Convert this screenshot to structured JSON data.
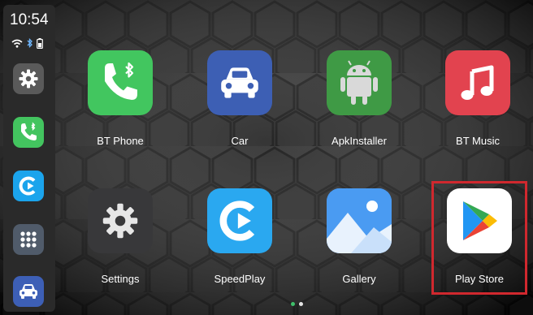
{
  "status": {
    "time": "10:54",
    "icons": [
      "wifi-icon",
      "bluetooth-icon",
      "battery-icon"
    ]
  },
  "sidebar": {
    "items": [
      {
        "name": "settings",
        "icon": "gear-icon",
        "color": "#6a6a6a"
      },
      {
        "name": "bt-phone",
        "icon": "phone-icon",
        "color": "#41c45e"
      },
      {
        "name": "speedplay",
        "icon": "speedplay-icon",
        "color": "#1aa3ec"
      },
      {
        "name": "app-grid",
        "icon": "grid-icon",
        "color": "#55606e"
      },
      {
        "name": "car",
        "icon": "car-icon",
        "color": "#3f62b8"
      }
    ]
  },
  "apps": [
    {
      "label": "BT Phone",
      "icon": "phone-icon",
      "color": "#42c65f"
    },
    {
      "label": "Car",
      "icon": "car-icon",
      "color": "#3d5fb4"
    },
    {
      "label": "ApkInstaller",
      "icon": "android-icon",
      "color": "#3f9a45"
    },
    {
      "label": "BT Music",
      "icon": "music-note-icon",
      "color": "#e2434f"
    },
    {
      "label": "Settings",
      "icon": "gear-icon",
      "color": "#3a3a3c"
    },
    {
      "label": "SpeedPlay",
      "icon": "speedplay-icon",
      "color": "#2aa8f0"
    },
    {
      "label": "Gallery",
      "icon": "gallery-icon",
      "color": "#3c8ef0"
    },
    {
      "label": "Play Store",
      "icon": "play-store-icon",
      "color": "#ffffff"
    }
  ],
  "highlight_color": "#d0282e",
  "page_indicator": {
    "pages": 2,
    "current": 1
  }
}
